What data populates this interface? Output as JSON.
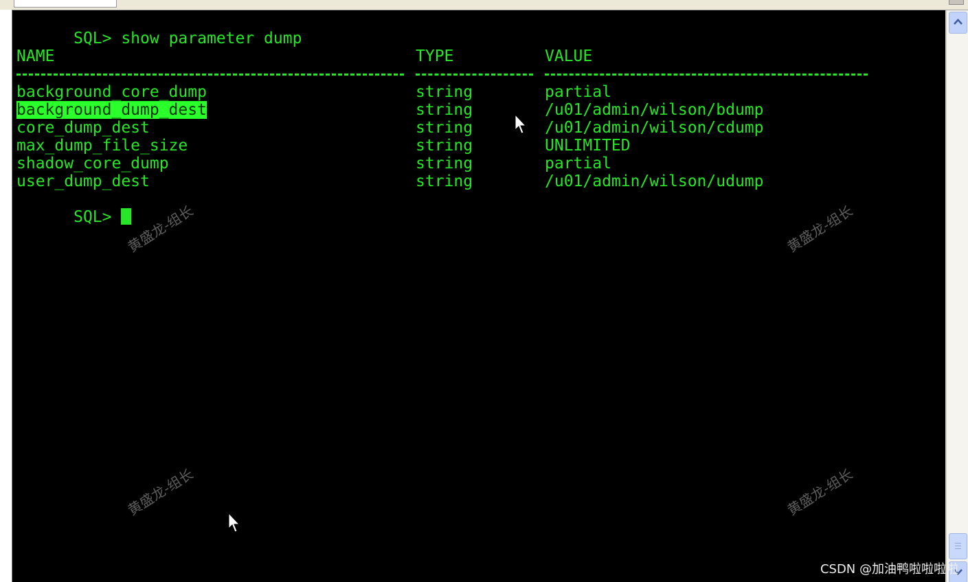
{
  "terminal": {
    "command_line": "SQL> show parameter dump",
    "headers": {
      "name": "NAME",
      "type": "TYPE",
      "value": "VALUE"
    },
    "rows": [
      {
        "name": "background_core_dump",
        "type": "string",
        "value": "partial"
      },
      {
        "name": "background_dump_dest",
        "type": "string",
        "value": "/u01/admin/wilson/bdump",
        "highlighted": true
      },
      {
        "name": "core_dump_dest",
        "type": "string",
        "value": "/u01/admin/wilson/cdump"
      },
      {
        "name": "max_dump_file_size",
        "type": "string",
        "value": "UNLIMITED"
      },
      {
        "name": "shadow_core_dump",
        "type": "string",
        "value": "partial"
      },
      {
        "name": "user_dump_dest",
        "type": "string",
        "value": "/u01/admin/wilson/udump"
      }
    ],
    "prompt": "SQL> ",
    "text_color": "#27e627",
    "highlight_color": "#2bff2b",
    "background_color": "#000000"
  },
  "watermarks": [
    "黄盛龙-组长",
    "黄盛龙-组长",
    "黄盛龙-组长",
    "黄盛龙-组长"
  ],
  "credit": "CSDN @加油鸭啦啦啦啦",
  "icons": {
    "scroll_up": "chevron-up-icon",
    "scroll_down": "chevron-down-icon",
    "pointer": "mouse-pointer-icon"
  }
}
